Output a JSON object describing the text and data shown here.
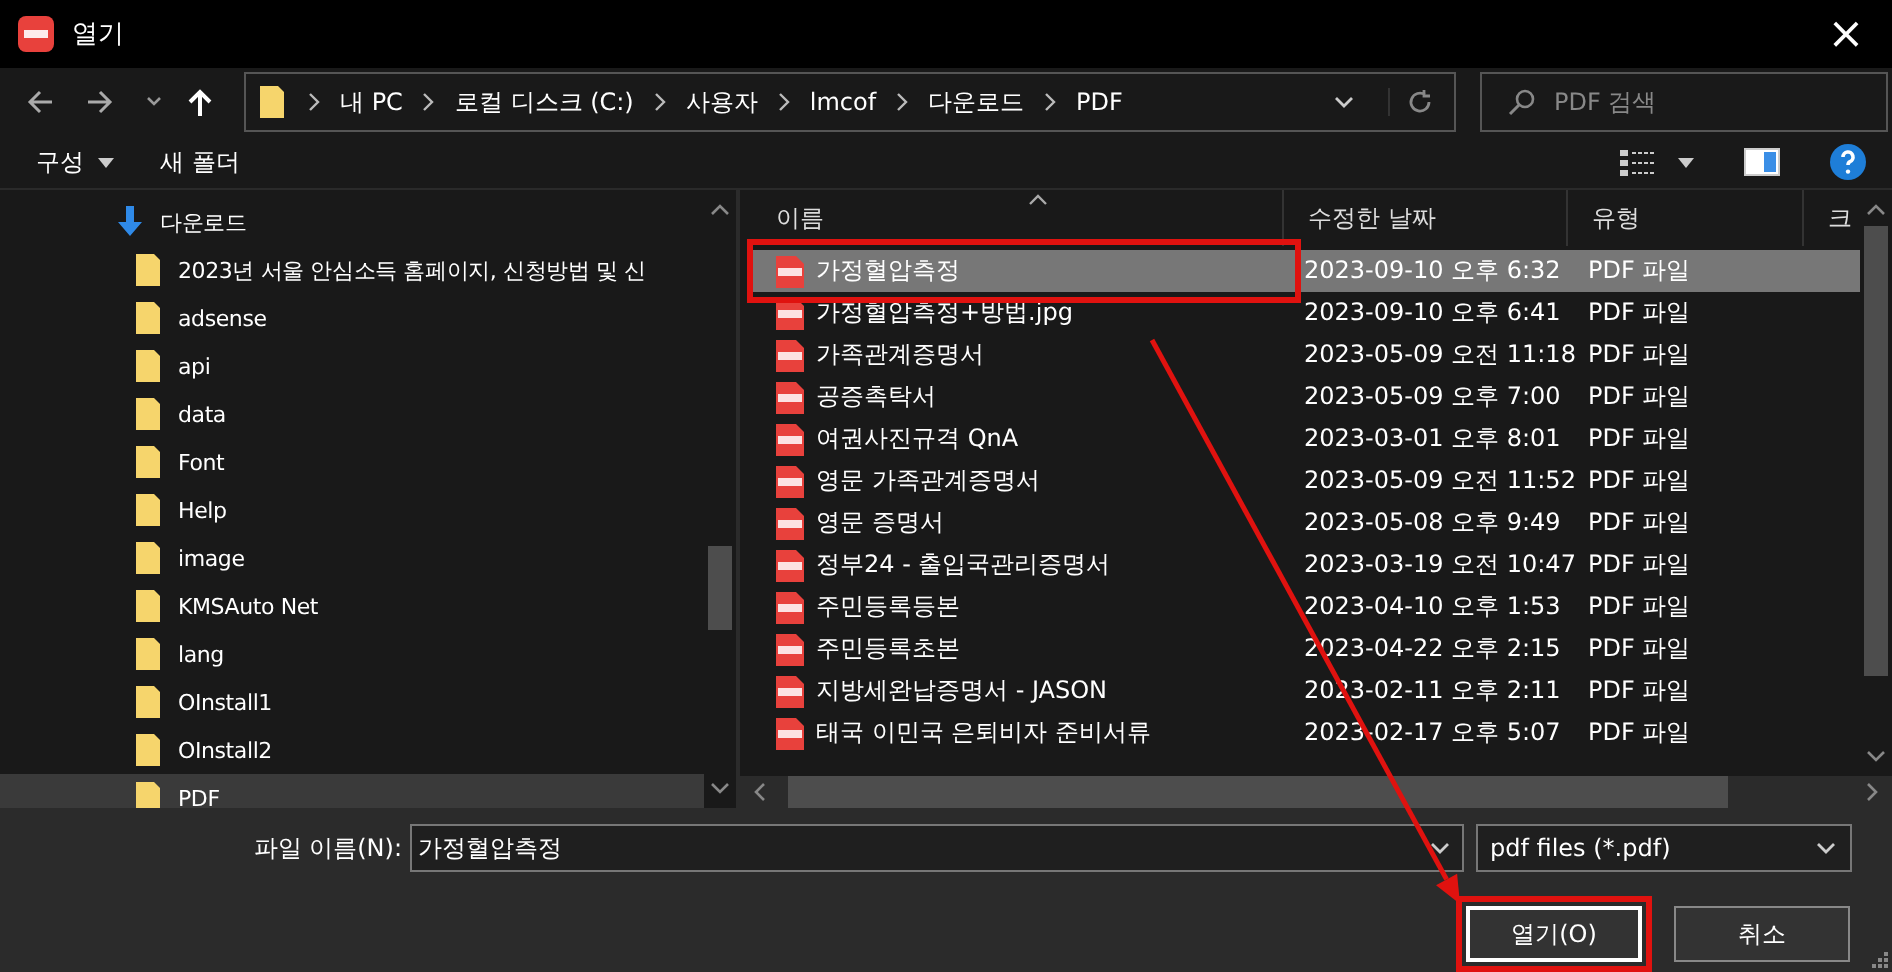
{
  "window": {
    "title": "열기",
    "close": "×"
  },
  "address": {
    "segments": [
      "내 PC",
      "로컬 디스크 (C:)",
      "사용자",
      "lmcof",
      "다운로드",
      "PDF"
    ]
  },
  "search": {
    "placeholder": "PDF 검색"
  },
  "toolbar": {
    "organize": "구성",
    "new_folder": "새 폴더"
  },
  "tree": [
    {
      "label": "다운로드",
      "kind": "download",
      "selected": false,
      "children": [
        {
          "label": "2023년 서울 안심소득 홈페이지, 신청방법 및 신",
          "kind": "folder",
          "selected": false
        },
        {
          "label": "adsense",
          "kind": "folder",
          "selected": false
        },
        {
          "label": "api",
          "kind": "folder",
          "selected": false
        },
        {
          "label": "data",
          "kind": "folder",
          "selected": false
        },
        {
          "label": "Font",
          "kind": "folder",
          "selected": false
        },
        {
          "label": "Help",
          "kind": "folder",
          "selected": false
        },
        {
          "label": "image",
          "kind": "folder",
          "selected": false
        },
        {
          "label": "KMSAuto Net",
          "kind": "folder",
          "selected": false
        },
        {
          "label": "lang",
          "kind": "folder",
          "selected": false
        },
        {
          "label": "OInstall1",
          "kind": "folder",
          "selected": false
        },
        {
          "label": "OInstall2",
          "kind": "folder",
          "selected": false
        },
        {
          "label": "PDF",
          "kind": "folder",
          "selected": true
        }
      ]
    }
  ],
  "table": {
    "columns": [
      "이름",
      "수정한 날짜",
      "유형",
      "크"
    ],
    "rows": [
      {
        "name": "가정혈압측정",
        "date": "2023-09-10 오후 6:32",
        "type": "PDF 파일",
        "selected": true,
        "highlighted": true
      },
      {
        "name": "가정혈압측정+방법.jpg",
        "date": "2023-09-10 오후 6:41",
        "type": "PDF 파일",
        "selected": false,
        "highlighted": false
      },
      {
        "name": "가족관계증명서",
        "date": "2023-05-09 오전 11:18",
        "type": "PDF 파일",
        "selected": false,
        "highlighted": false
      },
      {
        "name": "공증촉탁서",
        "date": "2023-05-09 오후 7:00",
        "type": "PDF 파일",
        "selected": false,
        "highlighted": false
      },
      {
        "name": "여권사진규격 QnA",
        "date": "2023-03-01 오후 8:01",
        "type": "PDF 파일",
        "selected": false,
        "highlighted": false
      },
      {
        "name": "영문 가족관계증명서",
        "date": "2023-05-09 오전 11:52",
        "type": "PDF 파일",
        "selected": false,
        "highlighted": false
      },
      {
        "name": "영문 증명서",
        "date": "2023-05-08 오후 9:49",
        "type": "PDF 파일",
        "selected": false,
        "highlighted": false
      },
      {
        "name": "정부24 - 출입국관리증명서",
        "date": "2023-03-19 오전 10:47",
        "type": "PDF 파일",
        "selected": false,
        "highlighted": false
      },
      {
        "name": "주민등록등본",
        "date": "2023-04-10 오후 1:53",
        "type": "PDF 파일",
        "selected": false,
        "highlighted": false
      },
      {
        "name": "주민등록초본",
        "date": "2023-04-22 오후 2:15",
        "type": "PDF 파일",
        "selected": false,
        "highlighted": false
      },
      {
        "name": "지방세완납증명서 - JASON",
        "date": "2023-02-11 오후 2:11",
        "type": "PDF 파일",
        "selected": false,
        "highlighted": false
      },
      {
        "name": "태국 이민국 은퇴비자 준비서류",
        "date": "2023-02-17 오후 5:07",
        "type": "PDF 파일",
        "selected": false,
        "highlighted": false
      }
    ]
  },
  "footer": {
    "filename_label": "파일 이름(N):",
    "filename": "가정혈압측정",
    "filter": "pdf files (*.pdf)",
    "buttons": [
      {
        "label": "열기(O)",
        "kind": "open",
        "highlighted": true
      },
      {
        "label": "취소",
        "kind": "cancel",
        "highlighted": false
      }
    ]
  },
  "annotation_arrow": true
}
